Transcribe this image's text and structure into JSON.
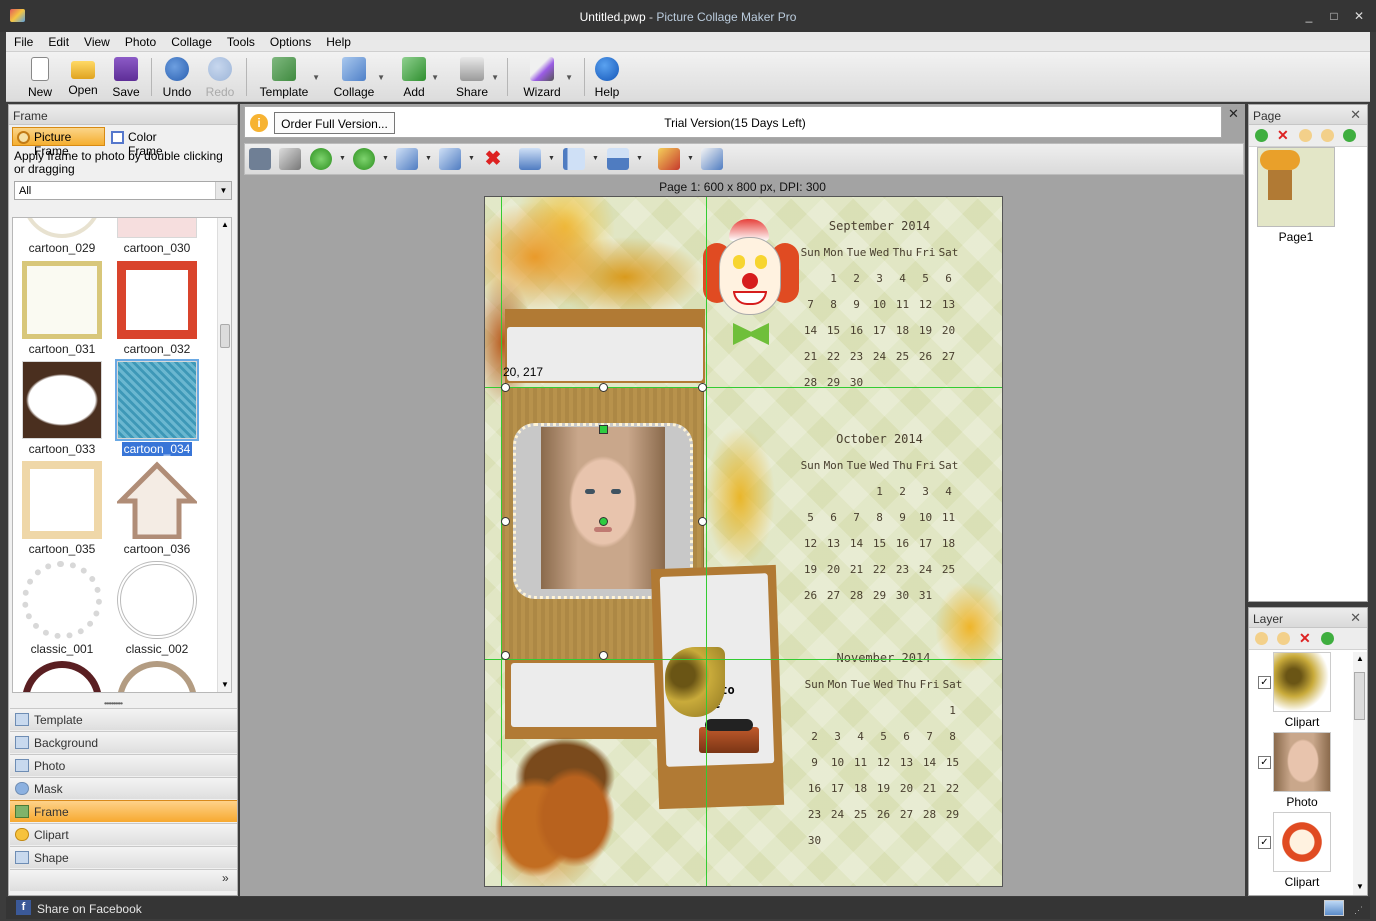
{
  "window": {
    "file_name": "Untitled.pwp",
    "separator": " - ",
    "app_name": "Picture Collage Maker Pro",
    "minimize": "_",
    "maximize": "□",
    "close": "✕"
  },
  "menu": [
    "File",
    "Edit",
    "View",
    "Photo",
    "Collage",
    "Tools",
    "Options",
    "Help"
  ],
  "toolbar": {
    "new": "New",
    "open": "Open",
    "save": "Save",
    "undo": "Undo",
    "redo": "Redo",
    "template": "Template",
    "collage": "Collage",
    "add": "Add",
    "share": "Share",
    "wizard": "Wizard",
    "help": "Help"
  },
  "left_panel": {
    "header": "Frame",
    "tab_picture": "Picture Frame",
    "tab_color": "Color Frame",
    "instruction": "Apply frame to photo by double clicking or dragging",
    "filter": "All",
    "frames": [
      {
        "label": "cartoon_029"
      },
      {
        "label": "cartoon_030"
      },
      {
        "label": "cartoon_031"
      },
      {
        "label": "cartoon_032"
      },
      {
        "label": "cartoon_033"
      },
      {
        "label": "cartoon_034"
      },
      {
        "label": "cartoon_035"
      },
      {
        "label": "cartoon_036"
      },
      {
        "label": "classic_001"
      },
      {
        "label": "classic_002"
      }
    ],
    "selected_frame": "cartoon_034",
    "accordion": [
      "Template",
      "Background",
      "Photo",
      "Mask",
      "Frame",
      "Clipart",
      "Shape"
    ],
    "accordion_active": "Frame",
    "expand": "»"
  },
  "order_bar": {
    "button": "Order Full Version...",
    "trial": "Trial Version(15 Days Left)",
    "info": "i",
    "close": "✕"
  },
  "page_info": "Page 1: 600 x 800 px, DPI: 300",
  "canvas": {
    "coord": "20, 217",
    "photo_text_1": "oto",
    "photo_text_2": "e",
    "weekdays": [
      "Sun",
      "Mon",
      "Tue",
      "Wed",
      "Thu",
      "Fri",
      "Sat"
    ],
    "calendars": [
      {
        "title": "September  2014",
        "weeks": [
          [
            "",
            "1",
            "2",
            "3",
            "4",
            "5",
            "6"
          ],
          [
            "7",
            "8",
            "9",
            "10",
            "11",
            "12",
            "13"
          ],
          [
            "14",
            "15",
            "16",
            "17",
            "18",
            "19",
            "20"
          ],
          [
            "21",
            "22",
            "23",
            "24",
            "25",
            "26",
            "27"
          ],
          [
            "28",
            "29",
            "30",
            "",
            "",
            "",
            ""
          ]
        ]
      },
      {
        "title": "October  2014",
        "weeks": [
          [
            "",
            "",
            "",
            "1",
            "2",
            "3",
            "4"
          ],
          [
            "5",
            "6",
            "7",
            "8",
            "9",
            "10",
            "11"
          ],
          [
            "12",
            "13",
            "14",
            "15",
            "16",
            "17",
            "18"
          ],
          [
            "19",
            "20",
            "21",
            "22",
            "23",
            "24",
            "25"
          ],
          [
            "26",
            "27",
            "28",
            "29",
            "30",
            "31",
            ""
          ]
        ]
      },
      {
        "title": "November  2014",
        "weeks": [
          [
            "",
            "",
            "",
            "",
            "",
            "",
            "1"
          ],
          [
            "2",
            "3",
            "4",
            "5",
            "6",
            "7",
            "8"
          ],
          [
            "9",
            "10",
            "11",
            "12",
            "13",
            "14",
            "15"
          ],
          [
            "16",
            "17",
            "18",
            "19",
            "20",
            "21",
            "22"
          ],
          [
            "23",
            "24",
            "25",
            "26",
            "27",
            "28",
            "29"
          ],
          [
            "30",
            "",
            "",
            "",
            "",
            "",
            ""
          ]
        ]
      }
    ]
  },
  "page_panel": {
    "header": "Page",
    "close": "✕",
    "pages": [
      {
        "label": "Page1"
      }
    ]
  },
  "layer_panel": {
    "header": "Layer",
    "close": "✕",
    "items": [
      {
        "label": "Clipart"
      },
      {
        "label": "Photo"
      },
      {
        "label": "Clipart"
      }
    ]
  },
  "status": {
    "facebook": "Share on Facebook",
    "fb_letter": "f"
  }
}
